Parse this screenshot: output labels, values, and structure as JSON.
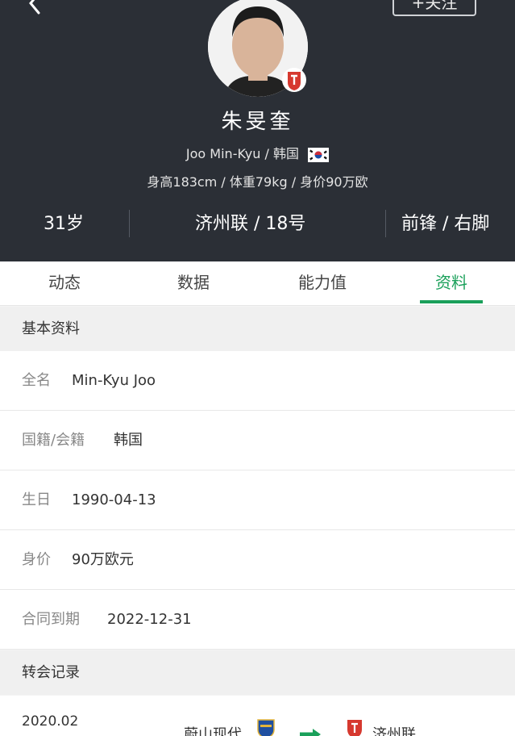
{
  "header": {
    "follow_label": "+关注",
    "player_name": "朱旻奎",
    "english_name": "Joo Min-Kyu",
    "nationality_short": "韩国",
    "sub_separator": " / ",
    "stats_line": "身高183cm / 体重79kg / 身价90万欧",
    "age": "31岁",
    "club_number": "济州联 / 18号",
    "position_foot": "前锋 / 右脚"
  },
  "tabs": [
    {
      "label": "动态"
    },
    {
      "label": "数据"
    },
    {
      "label": "能力值"
    },
    {
      "label": "资料"
    }
  ],
  "active_tab": "资料",
  "basic_info": {
    "title": "基本资料",
    "rows": [
      {
        "label": "全名",
        "value": "Min-Kyu Joo"
      },
      {
        "label": "国籍/会籍",
        "value": "韩国"
      },
      {
        "label": "生日",
        "value": "1990-04-13"
      },
      {
        "label": "身价",
        "value": "90万欧元"
      },
      {
        "label": "合同到期",
        "value": "2022-12-31"
      }
    ]
  },
  "transfers": {
    "title": "转会记录",
    "items": [
      {
        "date": "2020.02",
        "from": "蔚山现代",
        "to": "济州联"
      }
    ]
  },
  "colors": {
    "header_bg": "#2b2f36",
    "accent_green": "#1aa05a"
  }
}
